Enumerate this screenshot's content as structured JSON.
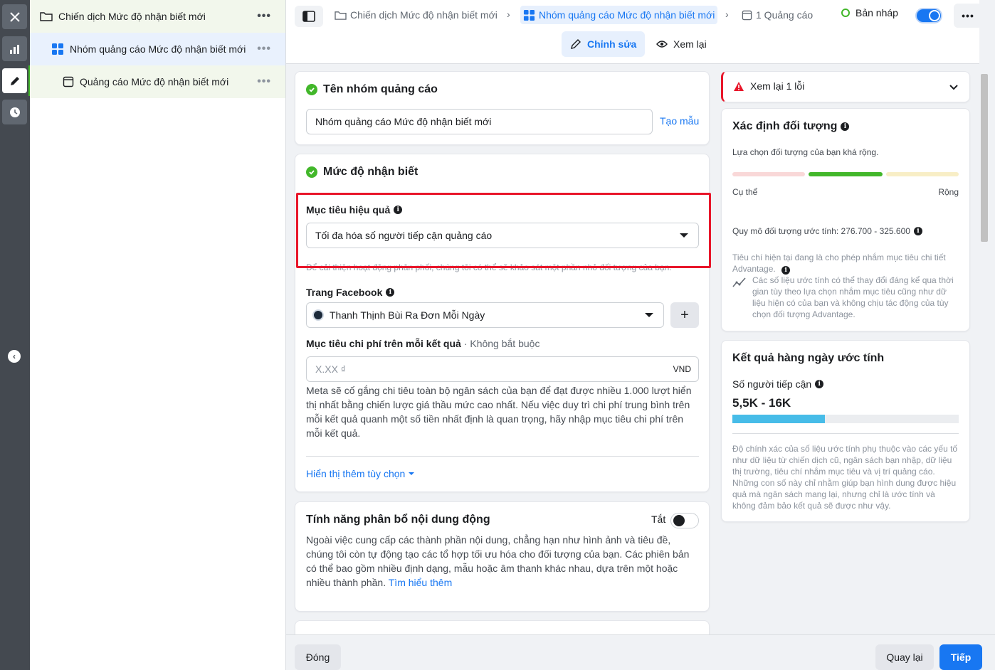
{
  "tree": {
    "campaign": "Chiến dịch Mức độ nhận biết mới",
    "adset": "Nhóm quảng cáo Mức độ nhận biết mới",
    "ad": "Quảng cáo Mức độ nhận biết mới",
    "more": "•••"
  },
  "header": {
    "crumb_campaign": "Chiến dịch Mức độ nhận biết mới",
    "crumb_adset": "Nhóm quảng cáo Mức độ nhận biết mới",
    "crumb_ads": "1 Quảng cáo",
    "status": "Bản nháp",
    "more": "•••",
    "tab_edit": "Chỉnh sửa",
    "tab_review": "Xem lại"
  },
  "adset_name": {
    "title": "Tên nhóm quảng cáo",
    "value": "Nhóm quảng cáo Mức độ nhận biết mới",
    "template_link": "Tạo mẫu"
  },
  "awareness": {
    "title": "Mức độ nhận biết",
    "goal_label": "Mục tiêu hiệu quả",
    "goal_value": "Tối đa hóa số người tiếp cận quảng cáo",
    "goal_hint": "Để cải thiện hoạt động phân phối, chúng tôi có thể sẽ khảo sát một phần nhỏ đối tượng của bạn.",
    "page_label": "Trang Facebook",
    "page_value": "Thanh Thịnh Bùi Ra Đơn Mỗi Ngày",
    "plus": "+",
    "cost_label": "Mục tiêu chi phí trên mỗi kết quả",
    "cost_optional": "· Không bắt buộc",
    "cost_placeholder": "X.XX ₫",
    "cost_currency": "VND",
    "cost_desc": "Meta sẽ cố gắng chi tiêu toàn bộ ngân sách của bạn để đạt được nhiều 1.000 lượt hiển thị nhất bằng chiến lược giá thầu mức cao nhất. Nếu việc duy trì chi phí trung bình trên mỗi kết quả quanh một số tiền nhất định là quan trọng, hãy nhập mục tiêu chi phí trên mỗi kết quả.",
    "more_options": "Hiển thị thêm tùy chọn"
  },
  "dynamic": {
    "title": "Tính năng phân bổ nội dung động",
    "toggle_label": "Tắt",
    "desc": "Ngoài việc cung cấp các thành phần nội dung, chẳng hạn như hình ảnh và tiêu đề, chúng tôi còn tự động tạo các tổ hợp tối ưu hóa cho đối tượng của bạn. Các phiên bản có thể bao gồm nhiều định dạng, mẫu hoặc âm thanh khác nhau, dựa trên một hoặc nhiều thành phần.",
    "learn_more": "Tìm hiểu thêm"
  },
  "review": {
    "label": "Xem lại 1 lỗi"
  },
  "audience": {
    "title": "Xác định đối tượng",
    "subtitle": "Lựa chọn đối tượng của bạn khá rộng.",
    "specific": "Cụ thể",
    "broad": "Rộng",
    "size": "Quy mô đối tượng ước tính: 276.700 - 325.600",
    "criteria": "Tiêu chí hiện tại đang là cho phép nhắm mục tiêu chi tiết Advantage.",
    "note": "Các số liệu ước tính có thể thay đổi đáng kể qua thời gian tùy theo lựa chọn nhắm mục tiêu cũng như dữ liệu hiện có của bạn và không chịu tác động của tùy chọn đối tượng Advantage."
  },
  "daily": {
    "title": "Kết quả hàng ngày ước tính",
    "reach_label": "Số người tiếp cận",
    "reach_value": "5,5K - 16K",
    "reach_fill": 0.41,
    "note": "Độ chính xác của số liệu ước tính phụ thuộc vào các yếu tố như dữ liệu từ chiến dịch cũ, ngân sách bạn nhập, dữ liệu thị trường, tiêu chí nhắm mục tiêu và vị trí quảng cáo. Những con số này chỉ nhằm giúp bạn hình dung được hiệu quả mà ngân sách mang lại, nhưng chỉ là ước tính và không đảm bảo kết quả sẽ được như vậy."
  },
  "footer": {
    "close": "Đóng",
    "back": "Quay lại",
    "next": "Tiếp"
  },
  "colors": {
    "accent": "#1877f2",
    "success": "#42b72a",
    "error": "#e8162a"
  }
}
